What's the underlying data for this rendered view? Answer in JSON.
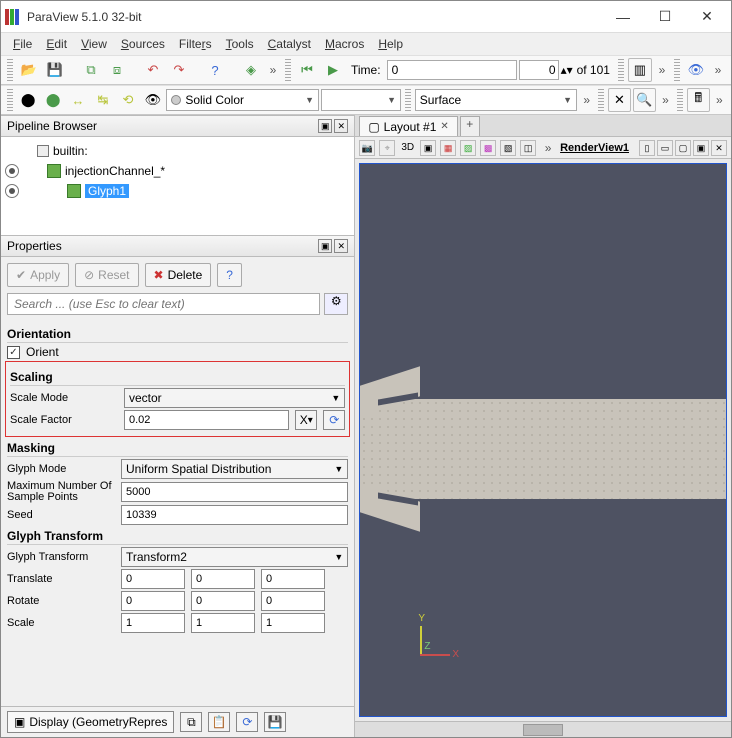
{
  "window": {
    "title": "ParaView 5.1.0 32-bit"
  },
  "menu": [
    "File",
    "Edit",
    "View",
    "Sources",
    "Filters",
    "Tools",
    "Catalyst",
    "Macros",
    "Help"
  ],
  "time": {
    "label": "Time:",
    "value": "0",
    "frame": "0",
    "of_label": "of 101"
  },
  "color_combo": "Solid Color",
  "repr_combo": "Surface",
  "pipeline": {
    "title": "Pipeline Browser",
    "root": "builtin:",
    "items": [
      "injectionChannel_*",
      "Glyph1"
    ]
  },
  "properties": {
    "title": "Properties",
    "apply": "Apply",
    "reset": "Reset",
    "delete": "Delete",
    "help": "?",
    "search_placeholder": "Search ... (use Esc to clear text)",
    "orientation": {
      "header": "Orientation",
      "orient_label": "Orient",
      "orient_checked": "✓"
    },
    "scaling": {
      "header": "Scaling",
      "mode_label": "Scale Mode",
      "mode_value": "vector",
      "factor_label": "Scale Factor",
      "factor_value": "0.02",
      "axis_btn": "X"
    },
    "masking": {
      "header": "Masking",
      "glyph_mode_label": "Glyph Mode",
      "glyph_mode_value": "Uniform Spatial Distribution",
      "max_pts_label": "Maximum Number Of Sample Points",
      "max_pts_value": "5000",
      "seed_label": "Seed",
      "seed_value": "10339"
    },
    "gtransform": {
      "header": "Glyph Transform",
      "label": "Glyph Transform",
      "value": "Transform2",
      "translate_label": "Translate",
      "translate": [
        "0",
        "0",
        "0"
      ],
      "rotate_label": "Rotate",
      "rotate": [
        "0",
        "0",
        "0"
      ],
      "scale_label": "Scale",
      "scale": [
        "1",
        "1",
        "1"
      ]
    },
    "display_label": "Display  (GeometryRepres"
  },
  "layout": {
    "tab": "Layout #1",
    "view_label": "RenderView1",
    "mode_3d": "3D"
  },
  "axis": {
    "x": "X",
    "y": "Y",
    "z": "Z"
  }
}
